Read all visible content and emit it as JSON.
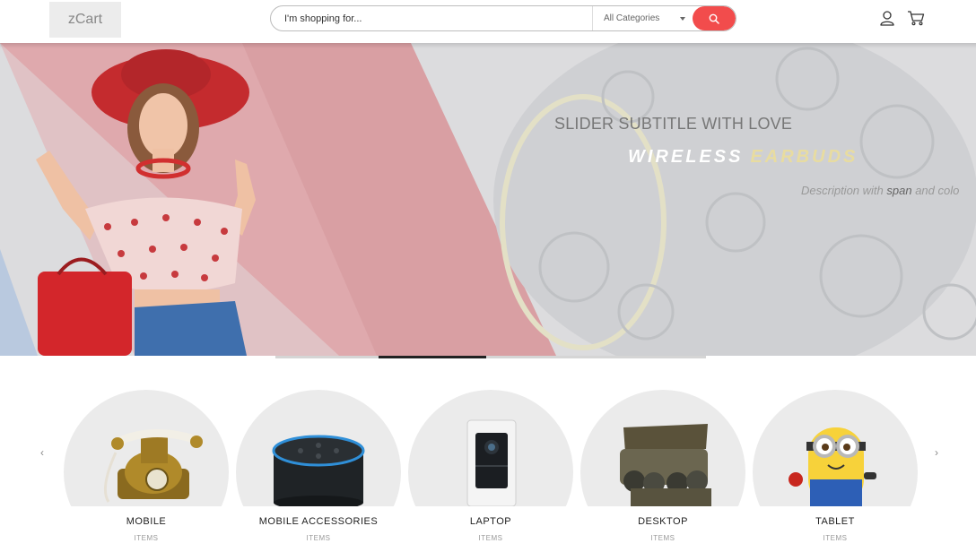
{
  "header": {
    "logo": "zCart",
    "search": {
      "placeholder": "I'm shopping for...",
      "category": "All Categories"
    }
  },
  "icons": {
    "search": "search-icon",
    "user": "user-icon",
    "cart": "cart-icon",
    "prev": "chevron-left-icon",
    "next": "chevron-right-icon"
  },
  "colors": {
    "accent": "#f24c4c",
    "pagination_active": "#222222"
  },
  "slider": {
    "subtitle": "SLIDER SUBTITLE WITH LOVE",
    "title_part1": "WIRELESS",
    "title_part2": "EARBUDS",
    "desc_before": "Description with ",
    "desc_span": "span",
    "desc_after": " and colo",
    "active_slide": 2,
    "slide_count": 4
  },
  "categories": {
    "prev": "‹",
    "next": "›",
    "items": [
      {
        "name": "MOBILE",
        "sub": "ITEMS"
      },
      {
        "name": "MOBILE ACCESSORIES",
        "sub": "ITEMS"
      },
      {
        "name": "LAPTOP",
        "sub": "ITEMS"
      },
      {
        "name": "DESKTOP",
        "sub": "ITEMS"
      },
      {
        "name": "TABLET",
        "sub": "ITEMS"
      }
    ]
  }
}
